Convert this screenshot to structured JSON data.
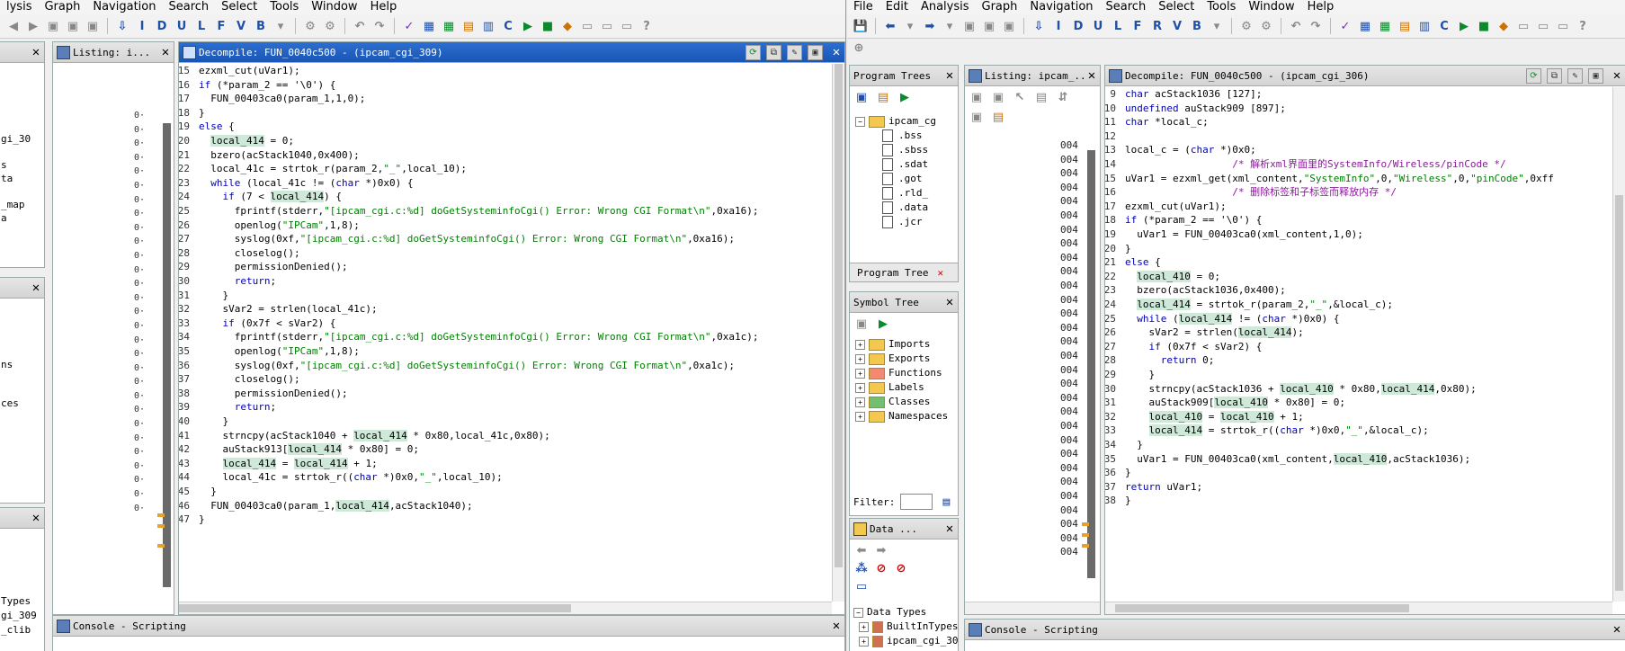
{
  "left_window": {
    "menu": [
      "lysis",
      "Graph",
      "Navigation",
      "Search",
      "Select",
      "Tools",
      "Window",
      "Help"
    ],
    "listing_title": "Listing:   i...",
    "decompile_title": "Decompile: FUN_0040c500 -  (ipcam_cgi_309)",
    "side_labels": [
      "gi_30",
      "s",
      "ta",
      "_map",
      "a"
    ],
    "side_labels2": [
      "ns",
      "ces"
    ],
    "side_labels3": [
      "Types",
      "gi_309",
      "_clib"
    ],
    "console_title": "Console - Scripting",
    "code": [
      {
        "n": "15",
        "t": "ezxml_cut(uVar1);"
      },
      {
        "n": "16",
        "t": "if (*param_2 == '\\0') {"
      },
      {
        "n": "17",
        "t": "  FUN_00403ca0(param_1,1,0);"
      },
      {
        "n": "18",
        "t": "}"
      },
      {
        "n": "19",
        "t": "else {"
      },
      {
        "n": "20",
        "t": "  local_414 = 0;"
      },
      {
        "n": "21",
        "t": "  bzero(acStack1040,0x400);"
      },
      {
        "n": "22",
        "t": "  local_41c = strtok_r(param_2,\"_\",local_10);"
      },
      {
        "n": "23",
        "t": "  while (local_41c != (char *)0x0) {"
      },
      {
        "n": "24",
        "t": "    if (7 < local_414) {"
      },
      {
        "n": "25",
        "t": "      fprintf(stderr,\"[ipcam_cgi.c:%d] doGetSysteminfoCgi() Error: Wrong CGI Format\\n\",0xa16);"
      },
      {
        "n": "26",
        "t": "      openlog(\"IPCam\",1,8);"
      },
      {
        "n": "27",
        "t": "      syslog(0xf,\"[ipcam_cgi.c:%d] doGetSysteminfoCgi() Error: Wrong CGI Format\\n\",0xa16);"
      },
      {
        "n": "28",
        "t": "      closelog();"
      },
      {
        "n": "29",
        "t": "      permissionDenied();"
      },
      {
        "n": "30",
        "t": "      return;"
      },
      {
        "n": "31",
        "t": "    }"
      },
      {
        "n": "32",
        "t": "    sVar2 = strlen(local_41c);"
      },
      {
        "n": "33",
        "t": "    if (0x7f < sVar2) {"
      },
      {
        "n": "34",
        "t": "      fprintf(stderr,\"[ipcam_cgi.c:%d] doGetSysteminfoCgi() Error: Wrong CGI Format\\n\",0xa1c);"
      },
      {
        "n": "35",
        "t": "      openlog(\"IPCam\",1,8);"
      },
      {
        "n": "36",
        "t": "      syslog(0xf,\"[ipcam_cgi.c:%d] doGetSysteminfoCgi() Error: Wrong CGI Format\\n\",0xa1c);"
      },
      {
        "n": "37",
        "t": "      closelog();"
      },
      {
        "n": "38",
        "t": "      permissionDenied();"
      },
      {
        "n": "39",
        "t": "      return;"
      },
      {
        "n": "40",
        "t": "    }"
      },
      {
        "n": "41",
        "t": "    strncpy(acStack1040 + local_414 * 0x80,local_41c,0x80);"
      },
      {
        "n": "42",
        "t": "    auStack913[local_414 * 0x80] = 0;"
      },
      {
        "n": "43",
        "t": "    local_414 = local_414 + 1;"
      },
      {
        "n": "44",
        "t": "    local_41c = strtok_r((char *)0x0,\"_\",local_10);"
      },
      {
        "n": "45",
        "t": "  }"
      },
      {
        "n": "46",
        "t": "  FUN_00403ca0(param_1,local_414,acStack1040);"
      },
      {
        "n": "47",
        "t": "}"
      }
    ]
  },
  "right_window": {
    "menu": [
      "File",
      "Edit",
      "Analysis",
      "Graph",
      "Navigation",
      "Search",
      "Select",
      "Tools",
      "Window",
      "Help"
    ],
    "program_trees_title": "Program Trees",
    "program_tree_root": "ipcam_cg",
    "program_tree_items": [
      ".bss",
      ".sbss",
      ".sdat",
      ".got",
      ".rld_",
      ".data",
      ".jcr"
    ],
    "program_tree_tab": "Program Tree",
    "symbol_tree_title": "Symbol Tree",
    "symbol_tree_items": [
      "Imports",
      "Exports",
      "Functions",
      "Labels",
      "Classes",
      "Namespaces"
    ],
    "filter_label": "Filter:",
    "data_types_title": "Data ...",
    "data_types_items": [
      "Data Types",
      "BuiltInTypes",
      "ipcam_cgi_30"
    ],
    "listing_title": "Listing:   ipcam_...",
    "listing_addrs": [
      "004",
      "004",
      "004",
      "004",
      "004",
      "004",
      "004",
      "004",
      "004",
      "004",
      "004",
      "004",
      "004",
      "004",
      "004",
      "004",
      "004",
      "004",
      "004",
      "004",
      "004",
      "004",
      "004",
      "004",
      "004",
      "004",
      "004",
      "004",
      "004",
      "004"
    ],
    "decompile_title": "Decompile: FUN_0040c500 -  (ipcam_cgi_306)",
    "console_title": "Console - Scripting",
    "code": [
      {
        "n": "9",
        "t": "char acStack1036 [127];"
      },
      {
        "n": "10",
        "t": "undefined auStack909 [897];"
      },
      {
        "n": "11",
        "t": "char *local_c;"
      },
      {
        "n": "12",
        "t": ""
      },
      {
        "n": "13",
        "t": "local_c = (char *)0x0;"
      },
      {
        "n": "14",
        "t": "                  /* 解析xml界面里的SystemInfo/Wireless/pinCode */"
      },
      {
        "n": "15",
        "t": "uVar1 = ezxml_get(xml_content,\"SystemInfo\",0,\"Wireless\",0,\"pinCode\",0xff"
      },
      {
        "n": "16",
        "t": "                  /* 删除标签和子标签而释放内存 */"
      },
      {
        "n": "17",
        "t": "ezxml_cut(uVar1);"
      },
      {
        "n": "18",
        "t": "if (*param_2 == '\\0') {"
      },
      {
        "n": "19",
        "t": "  uVar1 = FUN_00403ca0(xml_content,1,0);"
      },
      {
        "n": "20",
        "t": "}"
      },
      {
        "n": "21",
        "t": "else {"
      },
      {
        "n": "22",
        "t": "  local_410 = 0;"
      },
      {
        "n": "23",
        "t": "  bzero(acStack1036,0x400);"
      },
      {
        "n": "24",
        "t": "  local_414 = strtok_r(param_2,\"_\",&local_c);"
      },
      {
        "n": "25",
        "t": "  while (local_414 != (char *)0x0) {"
      },
      {
        "n": "26",
        "t": "    sVar2 = strlen(local_414);"
      },
      {
        "n": "27",
        "t": "    if (0x7f < sVar2) {"
      },
      {
        "n": "28",
        "t": "      return 0;"
      },
      {
        "n": "29",
        "t": "    }"
      },
      {
        "n": "30",
        "t": "    strncpy(acStack1036 + local_410 * 0x80,local_414,0x80);"
      },
      {
        "n": "31",
        "t": "    auStack909[local_410 * 0x80] = 0;"
      },
      {
        "n": "32",
        "t": "    local_410 = local_410 + 1;"
      },
      {
        "n": "33",
        "t": "    local_414 = strtok_r((char *)0x0,\"_\",&local_c);"
      },
      {
        "n": "34",
        "t": "  }"
      },
      {
        "n": "35",
        "t": "  uVar1 = FUN_00403ca0(xml_content,local_410,acStack1036);"
      },
      {
        "n": "36",
        "t": "}"
      },
      {
        "n": "37",
        "t": "return uVar1;"
      },
      {
        "n": "38",
        "t": "}"
      }
    ]
  },
  "colors": {
    "title_active": "#1956b5",
    "highlight": "#cfe9d9",
    "highlight_yellow": "#f8f86a",
    "keyword": "#0000b8",
    "string": "#008000",
    "comment": "#8a1a9a"
  }
}
